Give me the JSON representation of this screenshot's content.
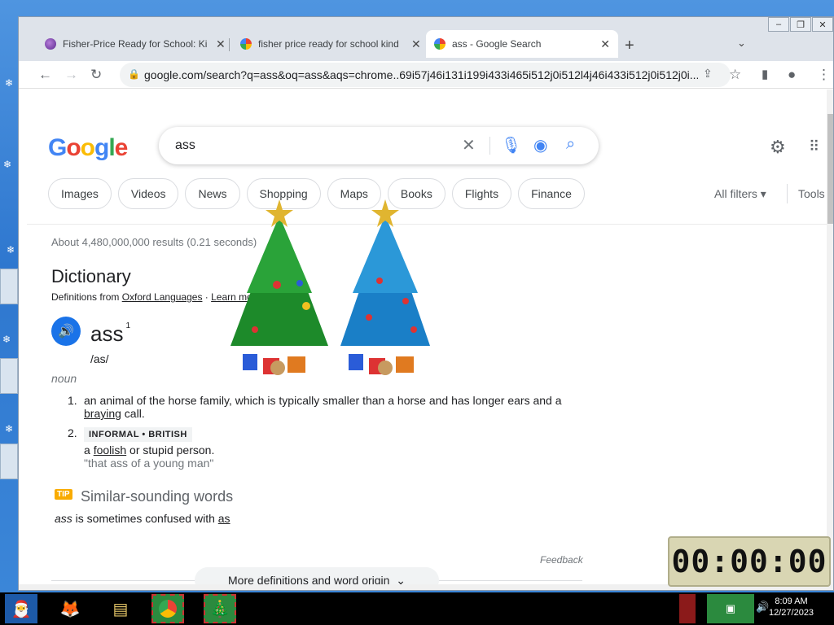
{
  "browser": {
    "tabs": [
      {
        "label": "Fisher-Price Ready for School: Ki",
        "favicon": "fisher-price-icon"
      },
      {
        "label": "fisher price ready for school kind",
        "favicon": "google-icon"
      },
      {
        "label": "ass - Google Search",
        "favicon": "google-icon",
        "active": true
      }
    ],
    "url": "google.com/search?q=ass&oq=ass&aqs=chrome..69i57j46i131i199i433i465i512j0i512l4j46i433i512j0i512j0i..."
  },
  "search": {
    "logo": "Google",
    "query": "ass",
    "chips": [
      "Images",
      "Videos",
      "News",
      "Shopping",
      "Maps",
      "Books",
      "Flights",
      "Finance"
    ],
    "all_filters": "All filters",
    "tools": "Tools",
    "stats": "About 4,480,000,000 results (0.21 seconds)"
  },
  "dictionary": {
    "heading": "Dictionary",
    "source_prefix": "Definitions from ",
    "source_link": "Oxford Languages",
    "learn_more": "Learn more",
    "word": "ass",
    "superscript": "1",
    "pronunciation": "/as/",
    "part_of_speech": "noun",
    "definitions": [
      {
        "num": "1.",
        "pre": "an animal of the horse family, which is typically smaller than a horse and has longer ears and a ",
        "link": "braying",
        "post": " call."
      },
      {
        "num": "2.",
        "tag": "INFORMAL • BRITISH",
        "pre": "a ",
        "link": "foolish",
        "post": " or stupid person.",
        "example": "\"that ass of a young man\""
      }
    ],
    "tip_badge": "TIP",
    "tip_title": "Similar-sounding words",
    "tip_word": "ass",
    "tip_text": " is sometimes confused with ",
    "tip_link": "as",
    "feedback": "Feedback",
    "more": "More definitions and word origin"
  },
  "overlay": {
    "clock": "00:00:00"
  },
  "taskbar": {
    "time": "8:09 AM",
    "date": "12/27/2023"
  }
}
